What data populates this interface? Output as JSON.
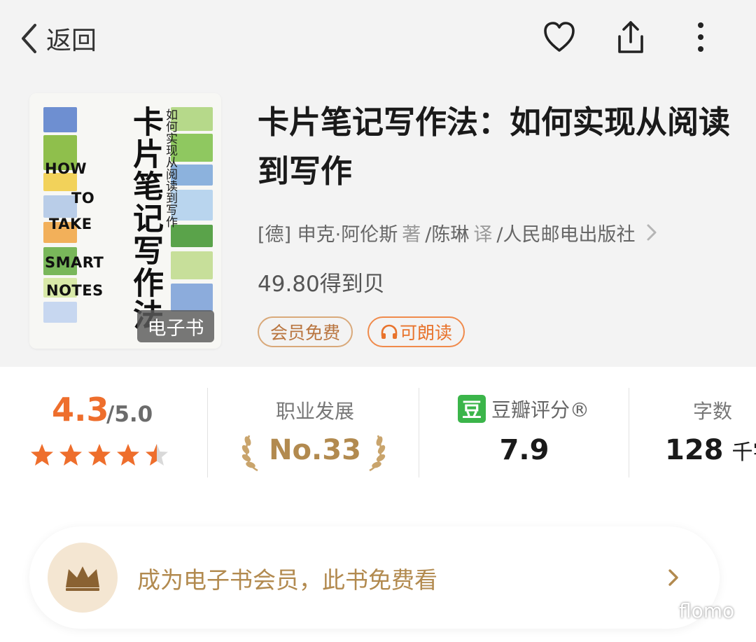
{
  "nav": {
    "back_label": "返回",
    "icons": [
      "chevron-left-icon",
      "heart-icon",
      "share-icon",
      "more-vertical-icon"
    ]
  },
  "book": {
    "cover": {
      "title_cn": "卡片笔记写作法",
      "subtitle_cn": "如何实现从阅读到写作",
      "title_en_lines": [
        "HOW",
        "TO",
        "TAKE",
        "SMART",
        "NOTES"
      ],
      "badge": "电子书"
    },
    "title": "卡片笔记写作法：如何实现从阅读到写作",
    "author_prefix": "[德] 申克·阿伦斯",
    "author_role": "著",
    "translator": "/陈琳",
    "translator_role": "译",
    "publisher": "/人民邮电出版社",
    "price": "49.80得到贝",
    "tags": {
      "member_free": "会员免费",
      "audio": "可朗读"
    }
  },
  "stats": {
    "rating": {
      "score": "4.3",
      "out_of": "/5.0",
      "stars": 4.5
    },
    "rank": {
      "category": "职业发展",
      "value": "No.33"
    },
    "douban": {
      "logo": "豆",
      "label": "豆瓣评分®",
      "value": "7.9"
    },
    "words": {
      "label": "字数",
      "value": "128",
      "unit": "千字"
    }
  },
  "member_banner": {
    "text": "成为电子书会员，此书免费看"
  },
  "watermark": {
    "text": "flomo"
  },
  "colors": {
    "accent_orange": "#ee6e2c",
    "gold": "#b28a4f",
    "douban_green": "#3bb54a",
    "page_bg": "#f3f3f3"
  }
}
